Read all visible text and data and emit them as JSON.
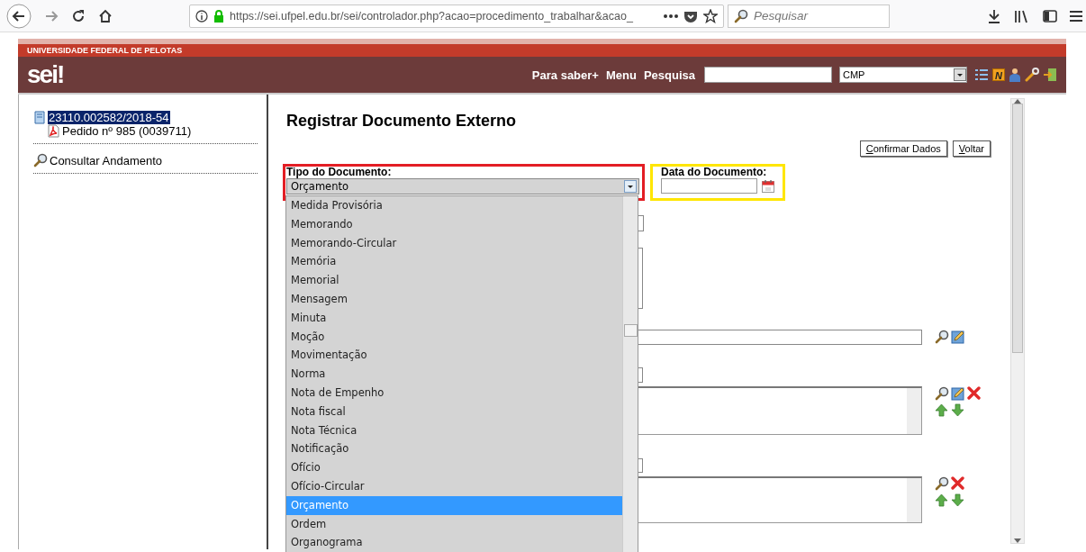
{
  "browser": {
    "url": "https://sei.ufpel.edu.br/sei/controlador.php?acao=procedimento_trabalhar&acao_",
    "search_placeholder": "Pesquisar"
  },
  "header": {
    "institution": "UNIVERSIDADE FEDERAL DE PELOTAS",
    "logo": "sei!",
    "links": [
      "Para saber+",
      "Menu",
      "Pesquisa"
    ],
    "unit": "CMP",
    "badge": "N"
  },
  "tree": {
    "process": {
      "label": "23110.002582/2018-54",
      "selected": true,
      "children": [
        {
          "label": "Pedido nº 985 (0039711)"
        }
      ]
    },
    "actions": [
      "Consultar Andamento"
    ]
  },
  "form": {
    "title": "Registrar Documento Externo",
    "buttons": [
      "Confirmar Dados",
      "Voltar"
    ],
    "fields": [
      {
        "kind": "select",
        "label": "Tipo do Documento:",
        "value": "Orçamento",
        "color": "#e31e24"
      },
      {
        "kind": "date",
        "label": "Data do Documento:",
        "color": "#ffe600"
      }
    ],
    "dropdown": {
      "options": [
        {
          "label": "Medida Provisória",
          "selected": false
        },
        {
          "label": "Memorando",
          "selected": false
        },
        {
          "label": "Memorando-Circular",
          "selected": false
        },
        {
          "label": "Memória",
          "selected": false
        },
        {
          "label": "Memorial",
          "selected": false
        },
        {
          "label": "Mensagem",
          "selected": false
        },
        {
          "label": "Minuta",
          "selected": false
        },
        {
          "label": "Moção",
          "selected": false
        },
        {
          "label": "Movimentação",
          "selected": false
        },
        {
          "label": "Norma",
          "selected": false
        },
        {
          "label": "Nota de Empenho",
          "selected": false
        },
        {
          "label": "Nota fiscal",
          "selected": false
        },
        {
          "label": "Nota Técnica",
          "selected": false
        },
        {
          "label": "Notificação",
          "selected": false
        },
        {
          "label": "Ofício",
          "selected": false
        },
        {
          "label": "Ofício-Circular",
          "selected": false
        },
        {
          "label": "Orçamento",
          "selected": true
        },
        {
          "label": "Ordem",
          "selected": false
        },
        {
          "label": "Organograma",
          "selected": false
        }
      ]
    }
  }
}
